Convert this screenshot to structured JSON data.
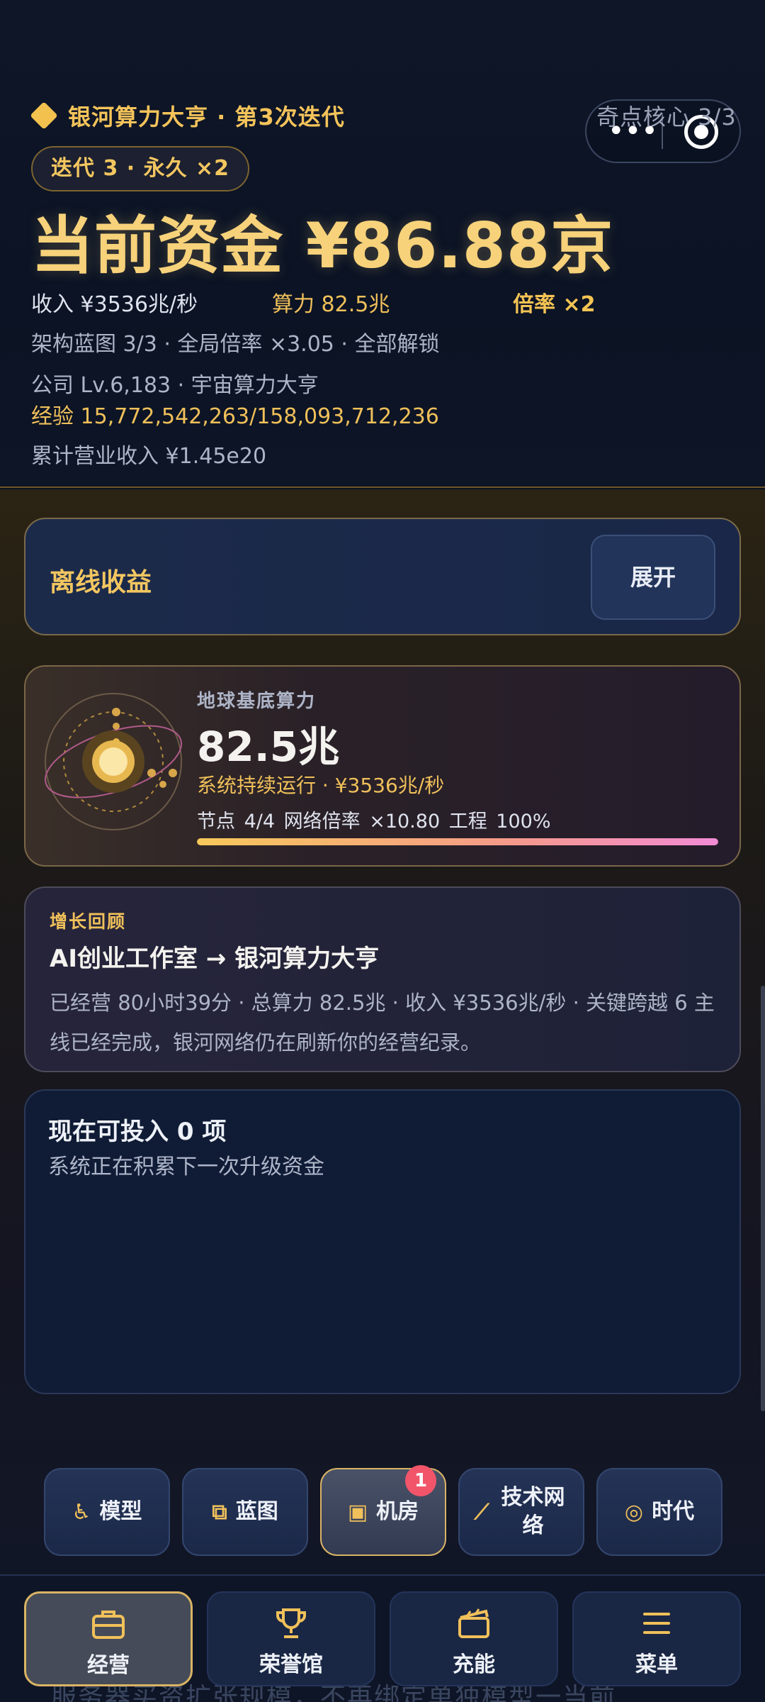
{
  "header": {
    "game_title": "银河算力大亨 · 第3次迭代",
    "mini_overlay_text": "奇点核心 3/3",
    "iteration_badge": "迭代 3 · 永久 ×2",
    "funds_text": "当前资金 ¥86.88京",
    "income": "收入 ¥3536兆/秒",
    "compute_power": "算力 82.5兆",
    "multiplier": "倍率 ×2",
    "blueprint_line": "架构蓝图 3/3 · 全局倍率 ×3.05 · 全部解锁",
    "company_line": "公司 Lv.6,183 · 宇宙算力大亨",
    "experience_line": "经验 15,772,542,263/158,093,712,236",
    "revenue_line": "累计营业收入 ¥1.45e20"
  },
  "offline": {
    "title": "离线收益",
    "expand_label": "展开"
  },
  "compute": {
    "label": "地球基底算力",
    "value": "82.5兆",
    "run_status": "系统持续运行 · ¥3536兆/秒",
    "metrics": "节点 4/4   网络倍率 ×10.80   工程 100%",
    "progress_pct": 100
  },
  "review": {
    "label": "增长回顾",
    "title": "AI创业工作室 → 银河算力大亨",
    "description": "已经营 80小时39分 · 总算力 82.5兆 · 收入 ¥3536兆/秒 · 关键跨越 6 主线已经完成，银河网络仍在刷新你的经营纪录。"
  },
  "invest": {
    "title": "现在可投入 0 项",
    "subtitle": "系统正在积累下一次升级资金"
  },
  "quick_nav": {
    "items": [
      {
        "label": "模型",
        "icon": "model-icon"
      },
      {
        "label": "蓝图",
        "icon": "blueprint-icon"
      },
      {
        "label": "机房",
        "icon": "server-room-icon",
        "badge": "1"
      },
      {
        "label": "技术网络",
        "icon": "tech-network-icon"
      },
      {
        "label": "时代",
        "icon": "era-icon"
      }
    ]
  },
  "tabbar": {
    "ghost_text": "服务器买资扩张规模，不再绑定单独模型一当前",
    "tabs": [
      {
        "label": "经营",
        "icon": "briefcase-icon"
      },
      {
        "label": "荣誉馆",
        "icon": "trophy-icon"
      },
      {
        "label": "充能",
        "icon": "clapperboard-icon"
      },
      {
        "label": "菜单",
        "icon": "menu-icon"
      }
    ]
  },
  "colors": {
    "accent_gold": "#f0c05a",
    "badge_red": "#f2556a",
    "card_navy": "#101c36"
  }
}
